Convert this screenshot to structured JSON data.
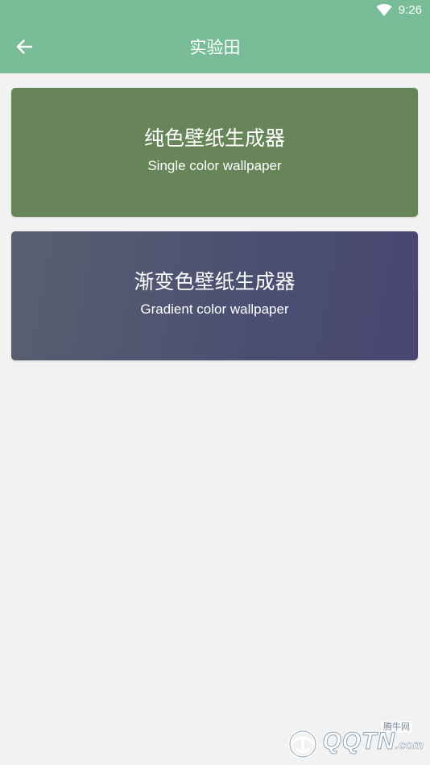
{
  "status_bar": {
    "time": "9:26",
    "icons": [
      "wifi-icon"
    ]
  },
  "app_bar": {
    "title": "实验田",
    "back_icon": "arrow-left-icon",
    "color": "#79bd98"
  },
  "cards": [
    {
      "title": "纯色壁纸生成器",
      "subtitle": "Single color wallpaper",
      "color": "#678558"
    },
    {
      "title": "渐变色壁纸生成器",
      "subtitle": "Gradient color wallpaper",
      "colors": [
        "#5a6070",
        "#4a4670"
      ]
    }
  ],
  "watermark": {
    "site_name": "腾牛网",
    "brand": "QQTN",
    "domain": ".com"
  },
  "colors": {
    "background": "#f2f2f2",
    "accent": "#79bd98"
  }
}
